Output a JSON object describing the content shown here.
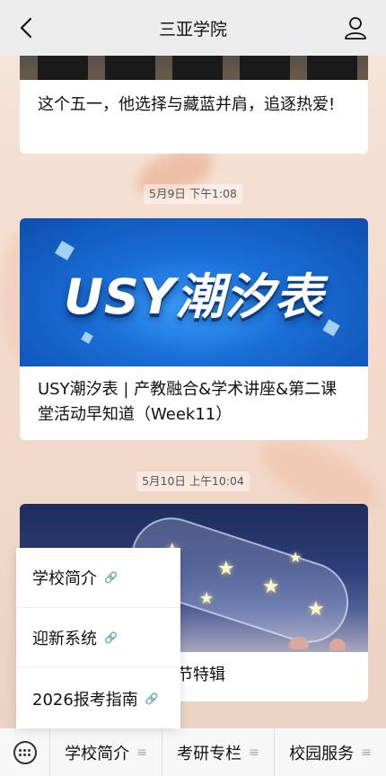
{
  "header": {
    "title": "三亚学院",
    "back_icon": "chevron-left-icon",
    "profile_icon": "user-icon"
  },
  "feed": {
    "articles": [
      {
        "title": "这个五一，他选择与藏蓝并肩，追逐热爱!"
      },
      {
        "timestamp": "5月9日 下午1:08",
        "banner_text": "USY潮汐表",
        "title": "USY潮汐表 | 产教融合&学术讲座&第二课堂活动早知道（Week11）"
      },
      {
        "timestamp": "5月10日 上午10:04",
        "title_visible": "节特辑"
      }
    ]
  },
  "popup_menu": {
    "items": [
      {
        "label": "学校简介"
      },
      {
        "label": "迎新系统"
      },
      {
        "label": "2026报考指南"
      }
    ]
  },
  "bottom_menu": {
    "keyboard_icon": "keyboard-icon",
    "tabs": [
      {
        "label": "学校简介"
      },
      {
        "label": "考研专栏"
      },
      {
        "label": "校园服务"
      }
    ]
  }
}
